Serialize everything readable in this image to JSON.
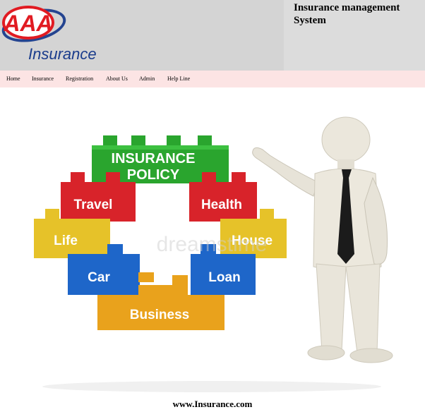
{
  "logo": {
    "brand_letters": "AAA",
    "brand_word": "Insurance",
    "colors": {
      "red": "#e11b22",
      "blue": "#1a3c8c"
    }
  },
  "header": {
    "title": "Insurance management System"
  },
  "nav": {
    "items": [
      {
        "label": "Home"
      },
      {
        "label": "Insurance"
      },
      {
        "label": "Registration"
      },
      {
        "label": "About Us"
      },
      {
        "label": "Admin"
      },
      {
        "label": "Help Line"
      }
    ]
  },
  "hero": {
    "blocks": [
      {
        "label": "INSURANCE POLICY",
        "color": "#2aa52e"
      },
      {
        "label": "Travel",
        "color": "#d8232a"
      },
      {
        "label": "Health",
        "color": "#d8232a"
      },
      {
        "label": "Life",
        "color": "#e6c229"
      },
      {
        "label": "House",
        "color": "#e6c229"
      },
      {
        "label": "Car",
        "color": "#1e66c9"
      },
      {
        "label": "Loan",
        "color": "#1e66c9"
      },
      {
        "label": "Business",
        "color": "#e9a21c"
      }
    ],
    "watermark": "dreamstime"
  },
  "footer": {
    "text": "www.Insurance.com"
  }
}
